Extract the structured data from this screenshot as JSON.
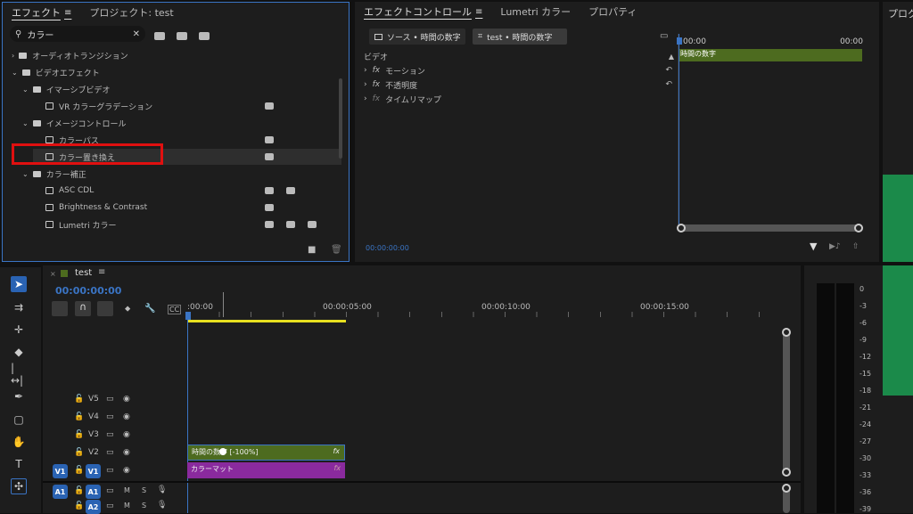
{
  "effects_panel": {
    "tabs": [
      "エフェクト",
      "プロジェクト: test"
    ],
    "search_value": "カラー",
    "tree": [
      {
        "label": "オーディオトランジション",
        "level": 0,
        "expanded": false
      },
      {
        "label": "ビデオエフェクト",
        "level": 0,
        "expanded": true
      },
      {
        "label": "イマーシブビデオ",
        "level": 1,
        "expanded": true
      },
      {
        "label": "VR カラーグラデーション",
        "level": 2,
        "leaf": true,
        "badges": 1
      },
      {
        "label": "イメージコントロール",
        "level": 1,
        "expanded": true
      },
      {
        "label": "カラーパス",
        "level": 2,
        "leaf": true,
        "badges": 1
      },
      {
        "label": "カラー置き換え",
        "level": 2,
        "leaf": true,
        "badges": 1,
        "selected": true
      },
      {
        "label": "カラー補正",
        "level": 1,
        "expanded": true
      },
      {
        "label": "ASC CDL",
        "level": 2,
        "leaf": true,
        "badges": 2
      },
      {
        "label": "Brightness & Contrast",
        "level": 2,
        "leaf": true,
        "badges": 1
      },
      {
        "label": "Lumetri カラー",
        "level": 2,
        "leaf": true,
        "badges": 3
      }
    ],
    "highlight_color": "#e01010"
  },
  "effect_controls": {
    "tabs": [
      "エフェクトコントロール",
      "Lumetri カラー",
      "プロパティ"
    ],
    "source_tab": "ソース • 時間の数字",
    "seq_tab": "test • 時間の数字",
    "section": "ビデオ",
    "rows": [
      "モーション",
      "不透明度",
      "タイムリマップ"
    ],
    "fx_label": "fx",
    "timecodes": [
      ":00:00",
      "00:00"
    ],
    "clip_label": "時間の数字",
    "timecode": "00:00:00:00"
  },
  "right_panel": {
    "tab": "プログ"
  },
  "timeline": {
    "sequence_name": "test",
    "timecode": "00:00:00:00",
    "ruler": [
      ":00:00",
      "00:00:05:00",
      "00:00:10:00",
      "00:00:15:00"
    ],
    "tracks": [
      {
        "label": "V5",
        "source": ""
      },
      {
        "label": "V4",
        "source": ""
      },
      {
        "label": "V3",
        "source": ""
      },
      {
        "label": "V2",
        "source": ""
      },
      {
        "label": "V1",
        "source": "V1"
      },
      {
        "label": "A1",
        "source": "A1"
      },
      {
        "label": "A2",
        "source": ""
      }
    ],
    "clips": [
      {
        "label": "時間の数字 [-100%]",
        "fx": "fx",
        "color": "#4d6b1f"
      },
      {
        "label": "カラーマット",
        "fx": "fx",
        "color": "#8a2a9e"
      }
    ],
    "audio_labels": {
      "m": "M",
      "s": "S"
    }
  },
  "meter": {
    "ticks": [
      "0",
      "-3",
      "-6",
      "-9",
      "-12",
      "-15",
      "-18",
      "-21",
      "-24",
      "-27",
      "-30",
      "-33",
      "-36",
      "-39"
    ]
  }
}
